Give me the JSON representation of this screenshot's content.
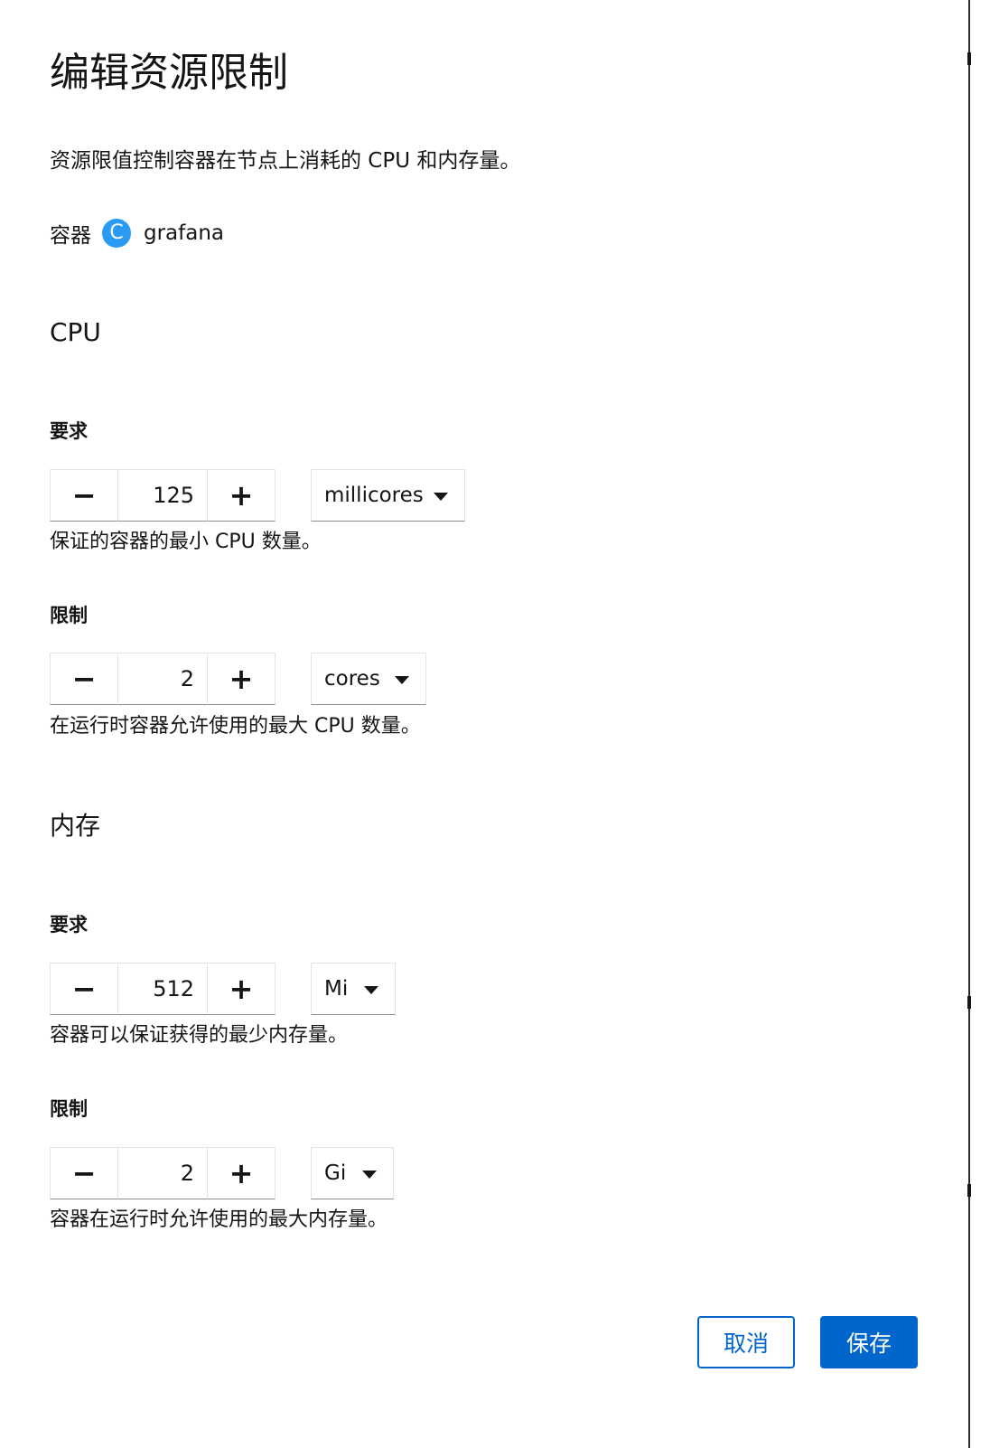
{
  "modal": {
    "title": "编辑资源限制",
    "description": "资源限值控制容器在节点上消耗的 CPU 和内存量。",
    "container_label": "容器",
    "container_badge": "C",
    "container_name": "grafana"
  },
  "cpu": {
    "section_title": "CPU",
    "request": {
      "label": "要求",
      "value": "125",
      "unit": "millicores",
      "helper": "保证的容器的最小 CPU 数量。"
    },
    "limit": {
      "label": "限制",
      "value": "2",
      "unit": "cores",
      "helper": "在运行时容器允许使用的最大 CPU 数量。"
    }
  },
  "memory": {
    "section_title": "内存",
    "request": {
      "label": "要求",
      "value": "512",
      "unit": "Mi",
      "helper": "容器可以保证获得的最少内存量。"
    },
    "limit": {
      "label": "限制",
      "value": "2",
      "unit": "Gi",
      "helper": "容器在运行时允许使用的最大内存量。"
    }
  },
  "spinner": {
    "minus": "−",
    "plus": "+"
  },
  "actions": {
    "cancel_label": "取消",
    "save_label": "保存"
  },
  "colors": {
    "primary": "#0066cc",
    "badge": "#2b9af3"
  }
}
